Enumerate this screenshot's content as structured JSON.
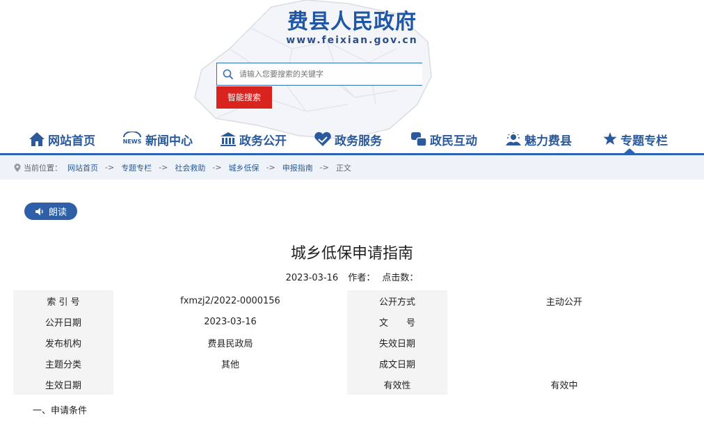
{
  "header": {
    "site_title": "费县人民政府",
    "site_url": "www.feixian.gov.cn",
    "brand_color": "#1f56a5"
  },
  "search": {
    "placeholder": "请输入您要搜索的关键字",
    "button_label": "智能搜索",
    "button_color": "#d9231e"
  },
  "nav": {
    "items": [
      {
        "label": "网站首页",
        "icon": "home-icon"
      },
      {
        "label": "新闻中心",
        "icon": "news-icon"
      },
      {
        "label": "政务公开",
        "icon": "building-icon"
      },
      {
        "label": "政务服务",
        "icon": "heart-hands-icon"
      },
      {
        "label": "政民互动",
        "icon": "interact-icon"
      },
      {
        "label": "魅力费县",
        "icon": "scenery-icon"
      },
      {
        "label": "专题专栏",
        "icon": "star-badge-icon"
      }
    ],
    "active_index": 6
  },
  "breadcrumb": {
    "prefix": "当前位置：",
    "separator": "->",
    "items": [
      "网站首页",
      "专题专栏",
      "社会救助",
      "城乡低保",
      "申报指南",
      "正文"
    ]
  },
  "read_button": {
    "label": "朗读"
  },
  "article": {
    "title": "城乡低保申请指南",
    "date": "2023-03-16",
    "author_label": "作者：",
    "clicks_label": "点击数：",
    "info_rows": [
      {
        "l1": "索 引 号",
        "v1": "fxmzj2/2022-0000156",
        "l2": "公开方式",
        "v2": "主动公开"
      },
      {
        "l1": "公开日期",
        "v1": "2023-03-16",
        "l2": "文　　号",
        "v2": ""
      },
      {
        "l1": "发布机构",
        "v1": "费县民政局",
        "l2": "失效日期",
        "v2": ""
      },
      {
        "l1": "主题分类",
        "v1": "其他",
        "l2": "成文日期",
        "v2": ""
      },
      {
        "l1": "生效日期",
        "v1": "",
        "l2": "有效性",
        "v2": "有效中"
      }
    ],
    "section_heading": "一、申请条件"
  }
}
